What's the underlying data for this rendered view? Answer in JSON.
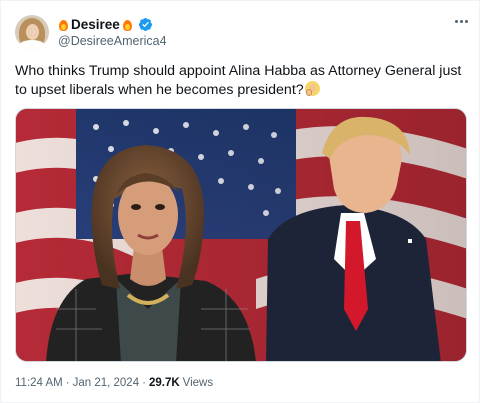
{
  "author": {
    "display_name": "Desiree",
    "handle": "@DesireeAmerica4",
    "name_emoji_left": "fire-icon",
    "name_emoji_right": "fire-icon",
    "badge": "verified-icon",
    "badge_color": "#1d9bf0"
  },
  "tweet": {
    "text": "Who thinks Trump should appoint Alina Habba as Attorney General just to upset liberals when he becomes president?",
    "trailing_emoji": "woman-raising-hand-emoji"
  },
  "meta": {
    "time": "11:24 AM",
    "separator": "·",
    "date": "Jan 21, 2024",
    "views_count": "29.7K",
    "views_label": "Views"
  },
  "colors": {
    "text": "#0f1419",
    "secondary": "#536471",
    "border": "#cfd9de"
  }
}
